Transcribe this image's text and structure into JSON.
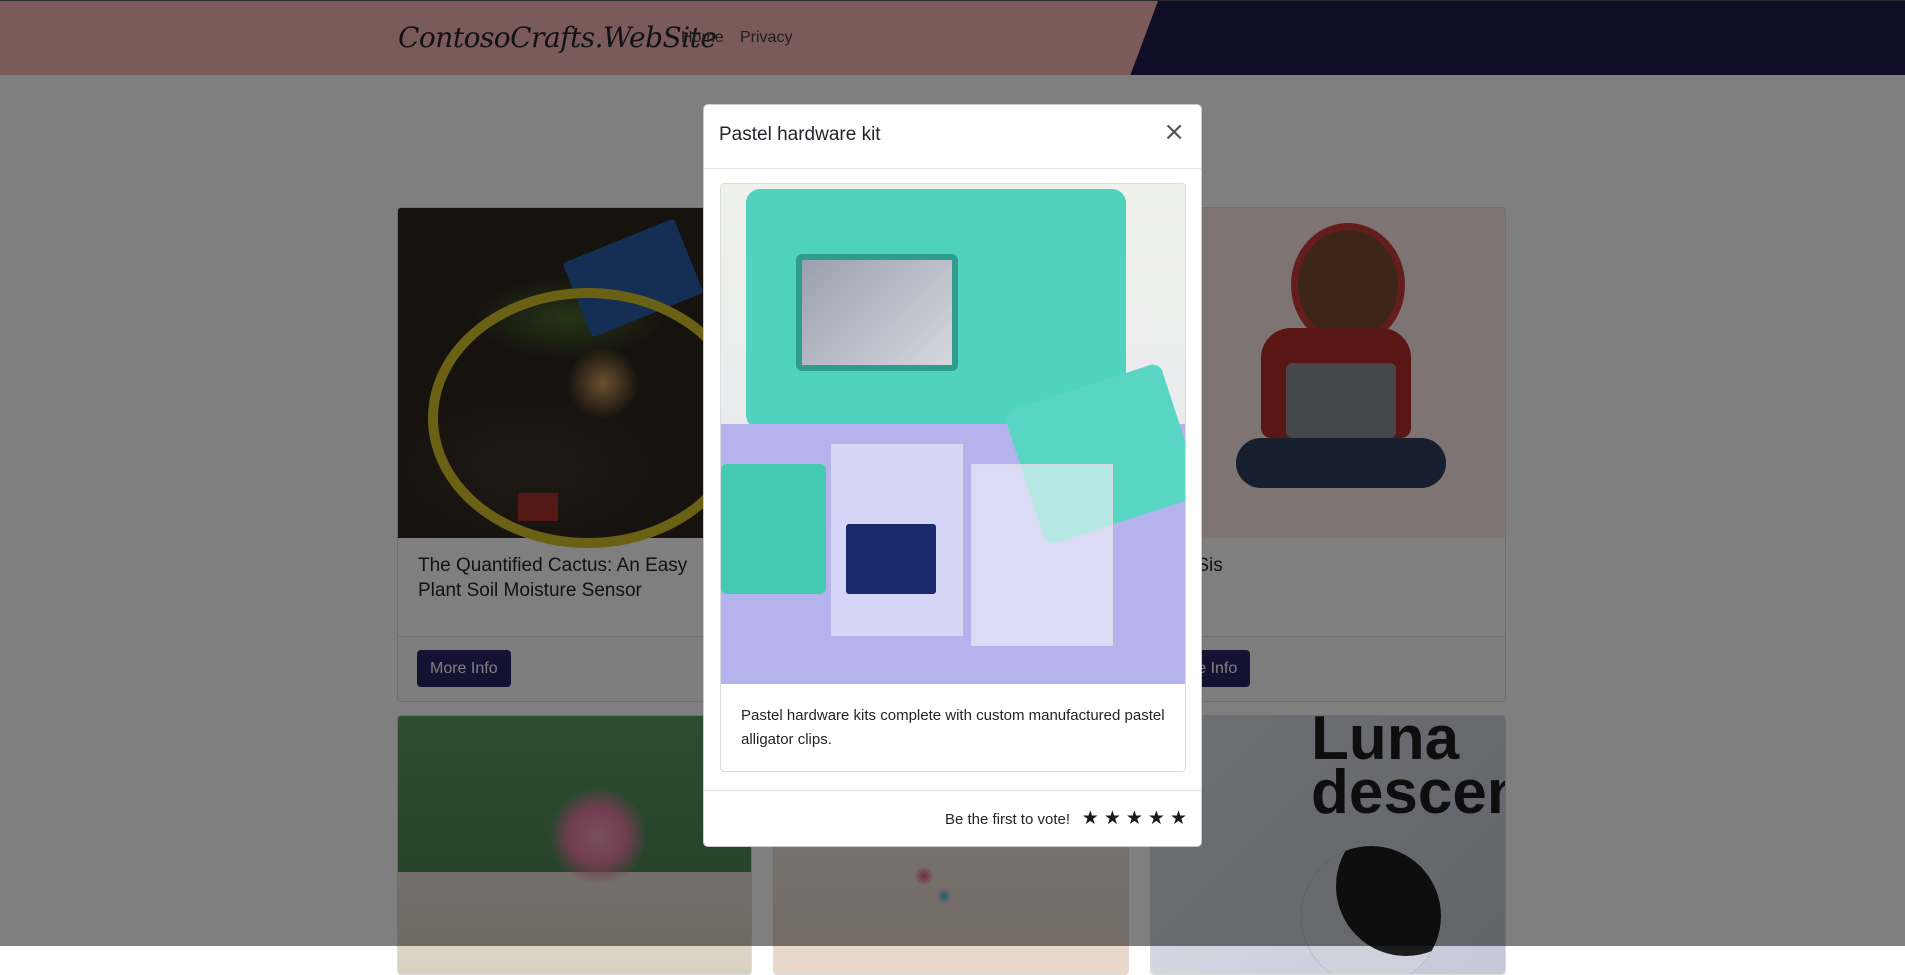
{
  "navbar": {
    "brand": "ContosoCrafts.WebSite",
    "links": [
      "Home",
      "Privacy"
    ]
  },
  "products": [
    {
      "title": "The Quantified Cactus: An Easy Plant Soil Moisture Sensor",
      "button": "More Info"
    },
    {
      "title": "oy Sis",
      "button": "ore Info"
    },
    {
      "luna_text": "Luna\ndescen"
    }
  ],
  "modal": {
    "title": "Pastel hardware kit",
    "close_icon": "×",
    "description": "Pastel hardware kits complete with custom manufactured pastel alligator clips.",
    "vote_text": "Be the first to vote!",
    "star_icon": "★",
    "star_count": 5
  },
  "colors": {
    "navbar_bg": "#f4b6b4",
    "navbar_dark": "#201d4e",
    "button_bg": "#2a2364"
  }
}
